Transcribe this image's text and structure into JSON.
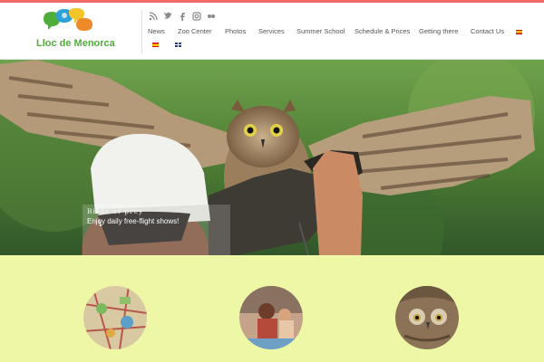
{
  "site": {
    "logo_text": "Lloc de Menorca"
  },
  "header": {
    "social_icons": [
      "rss-icon",
      "twitter-icon",
      "facebook-icon",
      "instagram-icon",
      "flickr-icon"
    ]
  },
  "nav": {
    "items": [
      {
        "label": "News"
      },
      {
        "label": "Zoo Center"
      },
      {
        "label": "Photos"
      },
      {
        "label": "Services"
      },
      {
        "label": "Summer School"
      },
      {
        "label": "Schedule & Prices"
      },
      {
        "label": "Getting there"
      },
      {
        "label": "Contact Us"
      }
    ],
    "languages": [
      "spanish-flag-icon",
      "english-flag-icon"
    ]
  },
  "hero": {
    "title": "Birds of prey",
    "subtitle": "Enjoy daily free-flight shows!"
  },
  "colors": {
    "accent": "#f06a6a",
    "page_bg": "#eef7a6",
    "logo_green": "#4fae3a"
  }
}
